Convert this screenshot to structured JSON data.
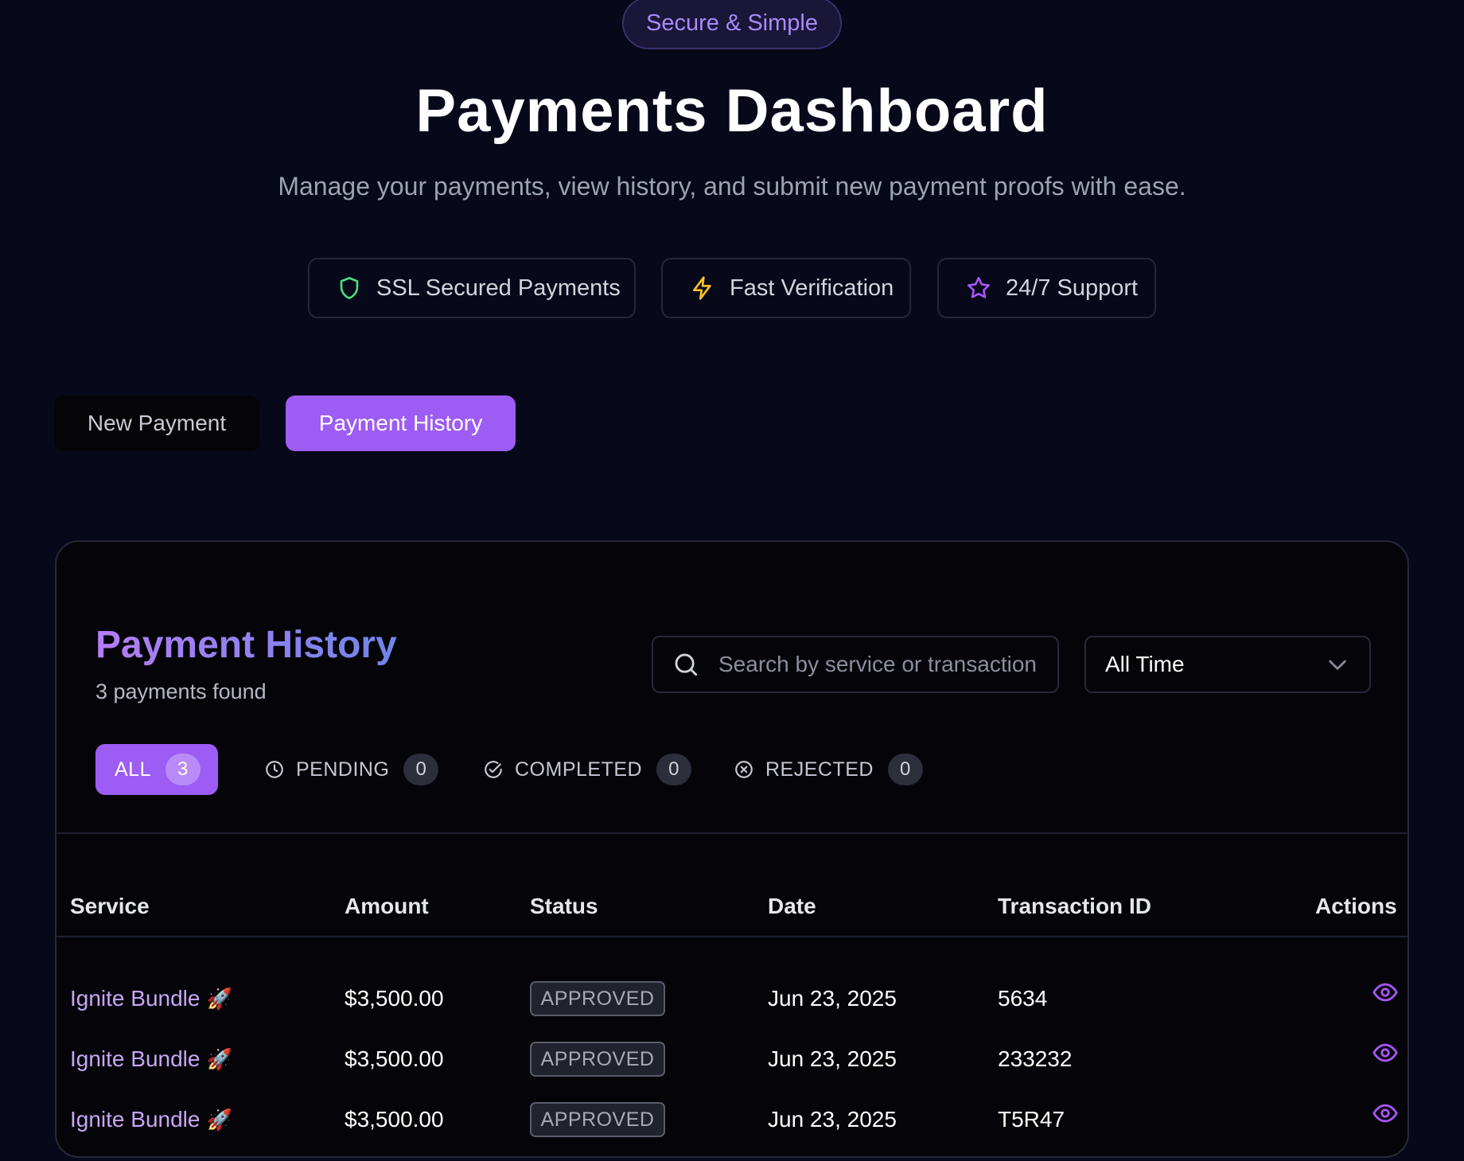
{
  "hero": {
    "badge": "Secure & Simple",
    "title": "Payments Dashboard",
    "subtitle": "Manage your payments, view history, and submit new payment proofs with ease.",
    "features": [
      {
        "icon": "shield-icon",
        "label": "SSL Secured Payments",
        "color": "#4ade80"
      },
      {
        "icon": "lightning-icon",
        "label": "Fast Verification",
        "color": "#fbbf24"
      },
      {
        "icon": "star-icon",
        "label": "24/7 Support",
        "color": "#a855f7"
      }
    ]
  },
  "tabs": {
    "new_payment": "New Payment",
    "payment_history": "Payment History",
    "active": "payment_history"
  },
  "history": {
    "title": "Payment History",
    "count_text": "3 payments found",
    "search_placeholder": "Search by service or transaction",
    "period": "All Time",
    "filters": [
      {
        "label": "ALL",
        "count": "3",
        "active": true
      },
      {
        "label": "PENDING",
        "count": "0",
        "icon": "clock-icon"
      },
      {
        "label": "COMPLETED",
        "count": "0",
        "icon": "check-circle-icon"
      },
      {
        "label": "REJECTED",
        "count": "0",
        "icon": "x-circle-icon"
      }
    ],
    "columns": [
      "Service",
      "Amount",
      "Status",
      "Date",
      "Transaction ID",
      "Actions"
    ],
    "rows": [
      {
        "service": "Ignite Bundle",
        "emoji": "🚀",
        "amount": "$3,500.00",
        "status": "APPROVED",
        "date": "Jun 23, 2025",
        "transaction_id": "5634"
      },
      {
        "service": "Ignite Bundle",
        "emoji": "🚀",
        "amount": "$3,500.00",
        "status": "APPROVED",
        "date": "Jun 23, 2025",
        "transaction_id": "233232"
      },
      {
        "service": "Ignite Bundle",
        "emoji": "🚀",
        "amount": "$3,500.00",
        "status": "APPROVED",
        "date": "Jun 23, 2025",
        "transaction_id": "T5R47"
      }
    ]
  },
  "colors": {
    "background": "#07081a",
    "accent": "#9d5cf3",
    "service_link": "#c8a6f7"
  }
}
